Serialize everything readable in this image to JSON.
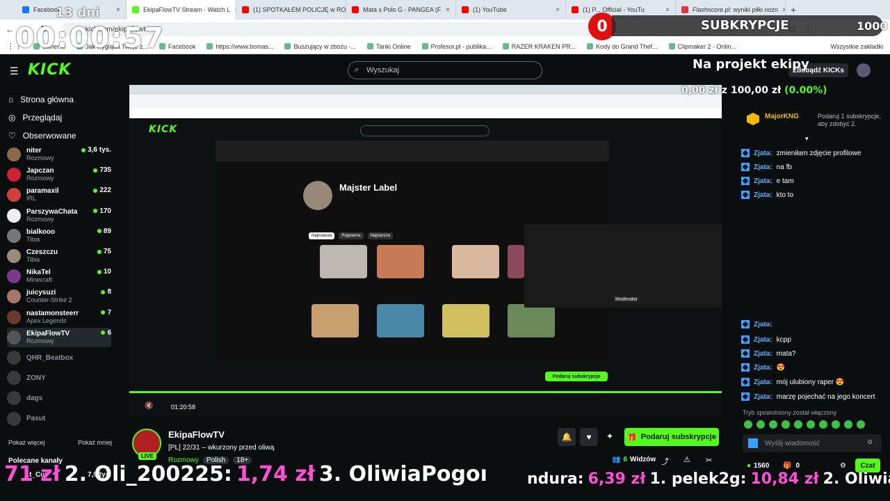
{
  "browser": {
    "tabs": [
      {
        "label": "Facebook",
        "color": "#1877f2"
      },
      {
        "label": "EkipaFlowTV Stream - Watch L",
        "color": "#53fc18"
      },
      {
        "label": "(1) SPOTKAŁEM POLICJĘ w RO",
        "color": "#ff0000"
      },
      {
        "label": "Mata x Polo G - PANGEA (F",
        "color": "#ff0000"
      },
      {
        "label": "(1) YouTube",
        "color": "#ff0000"
      },
      {
        "label": "(1) P... Official - YouTu",
        "color": "#ff0000"
      },
      {
        "label": "Flashscore.pl: wyniki piłki nożn",
        "color": "#e3363b"
      }
    ],
    "url": "kick.com/ekipaflowtv",
    "bookmarks": [
      "slither.io",
      "Jak wygląda Twoje z...",
      "Facebook",
      "https://www.bomas...",
      "Buszujący w zbożu -...",
      "Tanki Online",
      "Profesor.pl - publika...",
      "RAZER KRAKEN PR...",
      "Kody do Grand Thef...",
      "Clipmaker 2 - Onlin..."
    ],
    "bookmarks_all": "Wszystkie zakładki"
  },
  "overlay": {
    "days": "13 dni",
    "timer": "00:00:57",
    "sub_count": "0",
    "sub_label": "SUBKRYPCJE",
    "sub_goal": "1000",
    "project_title": "Na projekt ekipy",
    "project_current": "0,00 zł",
    "project_z": "z",
    "project_goal": "100,00 zł",
    "project_pct": "(0.00%)",
    "ticker_left": {
      "a": "71 zł",
      "b": "2. Oli_200225:",
      "c": "1,74 zł",
      "d": "3. OliwiaPogoı"
    },
    "ticker_right": {
      "a": "ndura:",
      "b": "6,39 zł",
      "c": "1. pelek2g:",
      "d": "10,84 zł",
      "e": "2. Oliwial"
    }
  },
  "nav": {
    "logo": "KICK",
    "search_placeholder": "Wyszukaj",
    "get_kicks": "Zdobądź KICKs"
  },
  "sidebar": {
    "menu": [
      {
        "label": "Strona główna",
        "icon": "home-icon"
      },
      {
        "label": "Przeglądaj",
        "icon": "compass-icon"
      },
      {
        "label": "Obserwowane",
        "icon": "heart-icon"
      }
    ],
    "channels": [
      {
        "name": "niter",
        "category": "Rozmowy",
        "viewers": "3,6 tys.",
        "color": "#8a6a4a",
        "live": true
      },
      {
        "name": "Japczan",
        "category": "Rozmowy",
        "viewers": "735",
        "color": "#c23",
        "live": true
      },
      {
        "name": "paramaxil",
        "category": "IRL",
        "viewers": "222",
        "color": "#d04040",
        "live": true
      },
      {
        "name": "ParszywaChata",
        "category": "Rozmowy",
        "viewers": "170",
        "color": "#eee",
        "live": true
      },
      {
        "name": "bialkooo",
        "category": "Tibia",
        "viewers": "89",
        "color": "#777",
        "live": true
      },
      {
        "name": "Czeszczu",
        "category": "Tibia",
        "viewers": "75",
        "color": "#9a8a7a",
        "live": true
      },
      {
        "name": "NikaTel",
        "category": "Minecraft",
        "viewers": "10",
        "color": "#7a3a8a",
        "live": true
      },
      {
        "name": "juicysuzi",
        "category": "Counter-Strike 2",
        "viewers": "8",
        "color": "#aa7766",
        "live": true
      },
      {
        "name": "nastamonsteerr",
        "category": "Apex Legends",
        "viewers": "7",
        "color": "#6a3a2a",
        "live": true
      },
      {
        "name": "EkipaFlowTV",
        "category": "Rozmowy",
        "viewers": "6",
        "color": "#555",
        "live": true
      },
      {
        "name": "QHR_Beatbox",
        "category": "",
        "viewers": "",
        "color": "#666",
        "live": false
      },
      {
        "name": "ZONY",
        "category": "",
        "viewers": "",
        "color": "#666",
        "live": false
      },
      {
        "name": "dags",
        "category": "",
        "viewers": "",
        "color": "#666",
        "live": false
      },
      {
        "name": "Pasut",
        "category": "",
        "viewers": "",
        "color": "#666",
        "live": false
      }
    ],
    "show_more": "Pokaż więcej",
    "show_less": "Pokaż mniej",
    "recommended": "Polecane kanały",
    "rec_channel": "Lt_Cut",
    "rec_viewers": "7,9 tys."
  },
  "stream": {
    "channel": "EkipaFlowTV",
    "live_badge": "LIVE",
    "title": "[PL] 22/31 – wkurzony przed oliwą",
    "tags": [
      "Rozmowy",
      "Polish",
      "18+"
    ],
    "subscribe": "Podaruj subskrypcje",
    "viewers_count": "6",
    "viewers_label": "Widzów",
    "player_time": "01:20:58"
  },
  "chat": {
    "top_user": "MajorKNG",
    "gift_text": "Podaruj 1 subskrypcje, aby zdobyć 2.",
    "messages": [
      {
        "user": "Zjata:",
        "text": "zmieniłam zdjęcie profilowe"
      },
      {
        "user": "Zjata:",
        "text": "na fb"
      },
      {
        "user": "Zjata:",
        "text": "e tam"
      },
      {
        "user": "Zjata:",
        "text": "kto to"
      },
      {
        "user": "Zjata:",
        "text": ""
      },
      {
        "user": "Zjata:",
        "text": "kcpp"
      },
      {
        "user": "Zjata:",
        "text": "mata?"
      },
      {
        "user": "Zjata:",
        "text": "😍"
      },
      {
        "user": "Zjata:",
        "text": "mój ulubiony raper 😍"
      },
      {
        "user": "Zjata:",
        "text": "marzę pojechać na jego koncert"
      }
    ],
    "slow_mode": "Tryb spowolniony został włączony",
    "input_placeholder": "Wyślij wiadomość",
    "kicks_balance": "1560",
    "gifts_balance": "0",
    "send": "Czat"
  },
  "inner": {
    "yt_channel": "Majster Label",
    "yt_filters": [
      "Najnowsze",
      "Popularne",
      "Najstarsze"
    ],
    "moderator": "Moderator"
  }
}
